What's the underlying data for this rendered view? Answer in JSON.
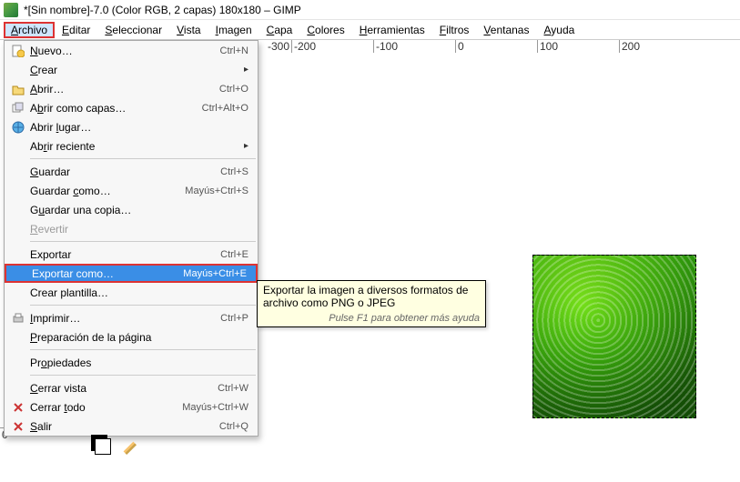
{
  "window": {
    "title": "*[Sin nombre]-7.0 (Color RGB, 2 capas) 180x180 – GIMP"
  },
  "menubar": {
    "items": [
      {
        "label": "Archivo",
        "u": "A"
      },
      {
        "label": "Editar",
        "u": "E"
      },
      {
        "label": "Seleccionar",
        "u": "S"
      },
      {
        "label": "Vista",
        "u": "V"
      },
      {
        "label": "Imagen",
        "u": "I"
      },
      {
        "label": "Capa",
        "u": "C"
      },
      {
        "label": "Colores",
        "u": "C"
      },
      {
        "label": "Herramientas",
        "u": "H"
      },
      {
        "label": "Filtros",
        "u": "F"
      },
      {
        "label": "Ventanas",
        "u": "V"
      },
      {
        "label": "Ayuda",
        "u": "A"
      }
    ]
  },
  "ruler_h": [
    "-300",
    "-200",
    "-100",
    "0",
    "100",
    "200"
  ],
  "ruler_v": [
    "0"
  ],
  "file_menu": {
    "items": [
      {
        "label": "Nuevo…",
        "u": "N",
        "shortcut": "Ctrl+N",
        "icon": "doc-new"
      },
      {
        "label": "Crear",
        "u": "C",
        "submenu": true
      },
      {
        "label": "Abrir…",
        "u": "A",
        "shortcut": "Ctrl+O",
        "icon": "open"
      },
      {
        "label": "Abrir como capas…",
        "u": "b",
        "shortcut": "Ctrl+Alt+O",
        "icon": "layers"
      },
      {
        "label": "Abrir lugar…",
        "u": "l",
        "icon": "globe"
      },
      {
        "label": "Abrir reciente",
        "u": "r",
        "submenu": true
      },
      {
        "sep": true
      },
      {
        "label": "Guardar",
        "u": "G",
        "shortcut": "Ctrl+S"
      },
      {
        "label": "Guardar como…",
        "u": "c",
        "shortcut": "Mayús+Ctrl+S"
      },
      {
        "label": "Guardar una copia…",
        "u": "u"
      },
      {
        "label": "Revertir",
        "disabled": true,
        "u": "R"
      },
      {
        "sep": true
      },
      {
        "label": "Exportar",
        "shortcut": "Ctrl+E"
      },
      {
        "label": "Exportar como…",
        "shortcut": "Mayús+Ctrl+E",
        "highlight": true
      },
      {
        "label": "Crear plantilla…"
      },
      {
        "sep": true
      },
      {
        "label": "Imprimir…",
        "u": "I",
        "shortcut": "Ctrl+P",
        "icon": "print"
      },
      {
        "label": "Preparación de la página",
        "u": "P"
      },
      {
        "sep": true
      },
      {
        "label": "Propiedades",
        "u": "o"
      },
      {
        "sep": true
      },
      {
        "label": "Cerrar vista",
        "u": "C",
        "shortcut": "Ctrl+W"
      },
      {
        "label": "Cerrar todo",
        "u": "t",
        "shortcut": "Mayús+Ctrl+W",
        "icon": "close"
      },
      {
        "label": "Salir",
        "u": "S",
        "shortcut": "Ctrl+Q",
        "icon": "close"
      }
    ]
  },
  "tooltip": {
    "text": "Exportar la imagen a diversos formatos de archivo como PNG o JPEG",
    "hint": "Pulse F1 para obtener más ayuda"
  }
}
